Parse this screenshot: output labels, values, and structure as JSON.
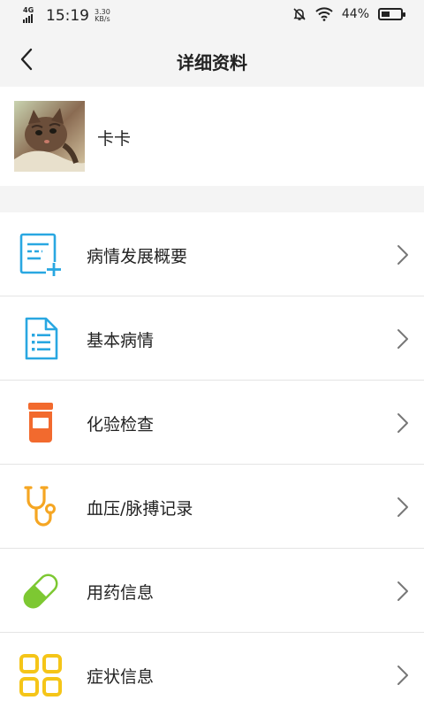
{
  "status": {
    "network": "4G",
    "time": "15:19",
    "speed_value": "3.30",
    "speed_unit": "KB/s",
    "battery": "44%",
    "battery_level": 0.44
  },
  "header": {
    "title": "详细资料"
  },
  "profile": {
    "name": "卡卡"
  },
  "menu": {
    "items": [
      {
        "label": "病情发展概要",
        "icon": "note-add-icon",
        "color": "#29a7e1"
      },
      {
        "label": "基本病情",
        "icon": "document-icon",
        "color": "#29a7e1"
      },
      {
        "label": "化验检查",
        "icon": "test-bottle-icon",
        "color": "#f26a2e"
      },
      {
        "label": "血压/脉搏记录",
        "icon": "stethoscope-icon",
        "color": "#f5a623"
      },
      {
        "label": "用药信息",
        "icon": "pill-icon",
        "color": "#7dc832"
      },
      {
        "label": "症状信息",
        "icon": "grid-icon",
        "color": "#f5c518"
      }
    ]
  }
}
